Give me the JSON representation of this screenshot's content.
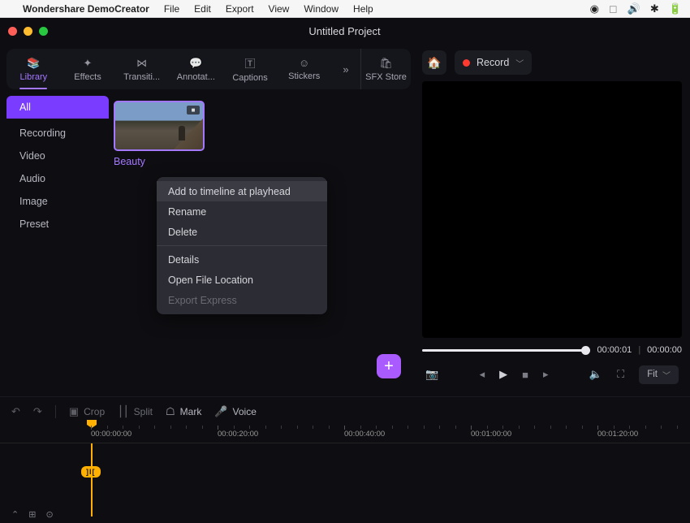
{
  "menubar": {
    "apple": "",
    "app": "Wondershare DemoCreator",
    "items": [
      "File",
      "Edit",
      "Export",
      "View",
      "Window",
      "Help"
    ]
  },
  "window": {
    "title": "Untitled Project"
  },
  "tabs": {
    "library": "Library",
    "effects": "Effects",
    "transitions": "Transiti...",
    "annotations": "Annotat...",
    "captions": "Captions",
    "stickers": "Stickers",
    "more": "»",
    "sfx": "SFX Store"
  },
  "categories": {
    "all": "All",
    "recording": "Recording",
    "video": "Video",
    "audio": "Audio",
    "image": "Image",
    "preset": "Preset"
  },
  "asset": {
    "label": "Beauty"
  },
  "context_menu": {
    "add": "Add to timeline at playhead",
    "rename": "Rename",
    "delete": "Delete",
    "details": "Details",
    "open": "Open File Location",
    "export": "Export Express"
  },
  "preview": {
    "record": "Record",
    "time_current": "00:00:01",
    "time_total": "00:00:00",
    "fit": "Fit"
  },
  "toolbar": {
    "crop": "Crop",
    "split": "Split",
    "mark": "Mark",
    "voice": "Voice"
  },
  "timeline": {
    "ticks": [
      "00:00:00:00",
      "00:00:20:00",
      "00:00:40:00",
      "00:01:00:00",
      "00:01:20:00"
    ],
    "badge": "]I["
  }
}
